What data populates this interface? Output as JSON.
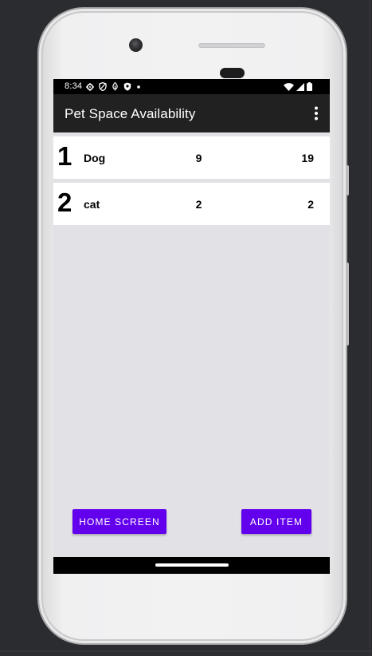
{
  "status_bar": {
    "time": "8:34",
    "left_icons": [
      "gear-icon",
      "shield-icon",
      "eco-icon",
      "badge-icon",
      "dot-icon"
    ],
    "right_icons": [
      "wifi-icon",
      "signal-icon",
      "battery-icon"
    ]
  },
  "app_bar": {
    "title": "Pet Space Availability",
    "overflow_icon": "more-vert-icon"
  },
  "list": {
    "items": [
      {
        "number": "1",
        "name": "Dog",
        "count": "9",
        "total": "19"
      },
      {
        "number": "2",
        "name": "cat",
        "count": "2",
        "total": "2"
      }
    ]
  },
  "buttons": {
    "home_label": "HOME SCREEN",
    "add_label": "ADD ITEM"
  },
  "colors": {
    "accent": "#6200ee",
    "app_bar": "#212121",
    "screen_bg": "#e2e1e6"
  }
}
